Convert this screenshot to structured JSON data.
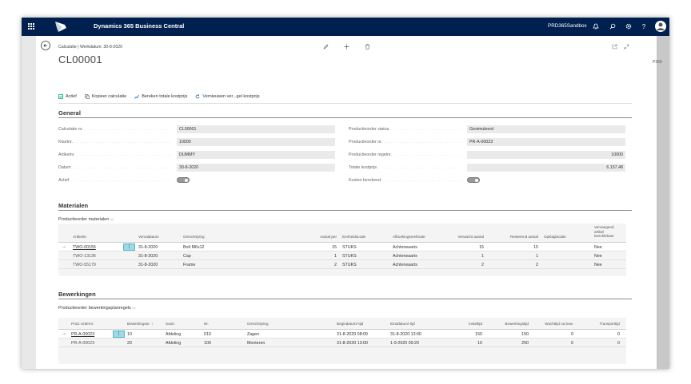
{
  "topbar": {
    "app_title": "Dynamics 365 Business Central",
    "environment": "PRD365Sandbox"
  },
  "rightrail": {
    "label": "P365"
  },
  "header": {
    "breadcrumb": "Calculatie | Werkdatum: 30-8-2020",
    "title": "CL00001"
  },
  "actions": [
    {
      "label": "Actief"
    },
    {
      "label": "Kopieer calculatie"
    },
    {
      "label": "Bereken totale kostprijs"
    },
    {
      "label": "Vernieuwen ver...gel kostprijs"
    }
  ],
  "general": {
    "title": "General",
    "left": [
      {
        "label": "Calculatie nr.",
        "value": "CL00001"
      },
      {
        "label": "Klantnr.",
        "value": "10000"
      },
      {
        "label": "Artikelnr.",
        "value": "DUMMY"
      },
      {
        "label": "Datum",
        "value": "30-8-2020"
      },
      {
        "label": "Actief",
        "value": ""
      }
    ],
    "right": [
      {
        "label": "Productieorder status",
        "value": "Gesimuleerd"
      },
      {
        "label": "Productieorder nr.",
        "value": "PR-A-00023"
      },
      {
        "label": "Productieorder regelnr.",
        "value": "10000"
      },
      {
        "label": "Totale kostprijs",
        "value": "6.157,48"
      },
      {
        "label": "Kosten berekend",
        "value": ""
      }
    ]
  },
  "materialen": {
    "title": "Materialen",
    "sub": "Productieorder materialen",
    "columns": [
      "Artikelnr.",
      "Vervaldatum",
      "Omschrijving",
      "Aantal per",
      "Eenheidscode",
      "Afboekingsmethode",
      "Verwacht aantal",
      "Resterend aantal",
      "Opslaglocatie",
      "Vervangend artikel beschikbaar"
    ],
    "rows": [
      [
        "TWO-00155",
        "31-8-2020",
        "Bolt M6x12",
        "15",
        "STUKS",
        "Achterwaarts",
        "15",
        "15",
        "",
        "Nee"
      ],
      [
        "TWO-13136",
        "31-8-2020",
        "Cap",
        "1",
        "STUKS",
        "Achterwaarts",
        "1",
        "1",
        "",
        "Nee"
      ],
      [
        "TWO-55179",
        "31-8-2020",
        "Frame",
        "2",
        "STUKS",
        "Achterwaarts",
        "2",
        "2",
        "",
        "Nee"
      ]
    ]
  },
  "bewerkingen": {
    "title": "Bewerkingen",
    "sub": "Productieorder bewerkingsplanregels",
    "columns": [
      "Prod.-ordernr.",
      "Bewerkingsnr. ↑",
      "Soort",
      "Nr.",
      "Omschrijving",
      "Begindatum/-tijd",
      "Einddatum/-tijd",
      "Insteltijd",
      "Bewerkingstijd",
      "Wachttijd na bew.",
      "Transporttijd"
    ],
    "rows": [
      [
        "PR-A-00023",
        "10",
        "Afdeling",
        "010",
        "Zagen",
        "31-8-2020 08:00",
        "31-8-2020 13:00",
        "150",
        "150",
        "0",
        "0"
      ],
      [
        "PR-A-00023",
        "20",
        "Afdeling",
        "100",
        "Monteren",
        "31-8-2020 13:00",
        "1-9-2020 09:20",
        "10",
        "250",
        "0",
        "0"
      ]
    ]
  }
}
